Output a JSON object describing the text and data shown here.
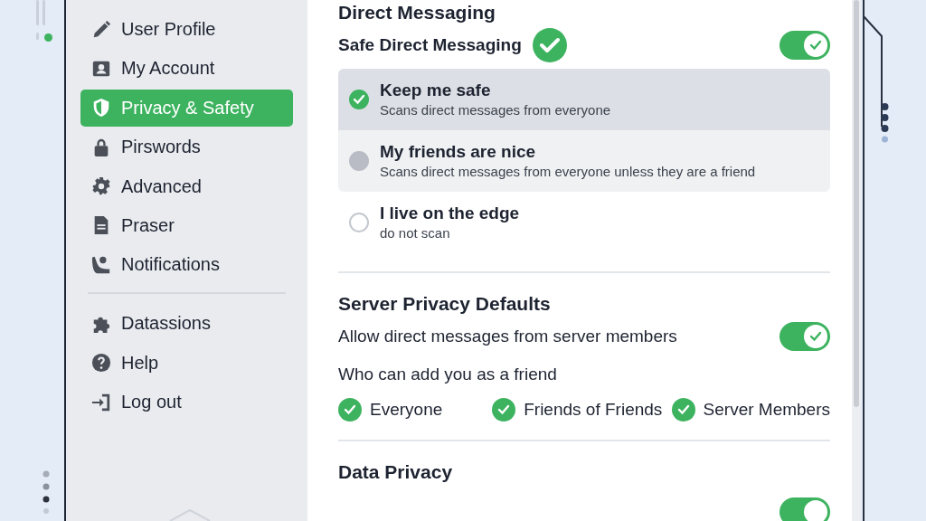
{
  "sidebar": {
    "groups": [
      [
        {
          "label": "User Profile",
          "selected": false
        },
        {
          "label": "My Account",
          "selected": false
        },
        {
          "label": "Privacy & Safety",
          "selected": true
        },
        {
          "label": "Pirswords",
          "selected": false
        },
        {
          "label": "Advanced",
          "selected": false
        },
        {
          "label": "Praser",
          "selected": false
        },
        {
          "label": "Notifications",
          "selected": false
        }
      ],
      [
        {
          "label": "Datassions",
          "selected": false
        },
        {
          "label": "Help",
          "selected": false
        },
        {
          "label": "Log out",
          "selected": false
        }
      ]
    ]
  },
  "direct_messaging": {
    "title": "Direct Messaging",
    "safe_toggle": {
      "label": "Safe Direct Messaging",
      "verified": true,
      "on": true
    },
    "options": [
      {
        "title": "Keep me safe",
        "description": "Scans direct messages from everyone",
        "selected": true,
        "highlighted": false
      },
      {
        "title": "My friends are nice",
        "description": "Scans direct messages from everyone unless they are a friend",
        "selected": false,
        "highlighted": true
      },
      {
        "title": "I live on the edge",
        "description": "do not scan",
        "selected": false,
        "highlighted": false
      }
    ]
  },
  "server_privacy": {
    "title": "Server Privacy Defaults",
    "dm_toggle": {
      "label": "Allow direct messages from server members",
      "on": true
    },
    "friend_label": "Who can add you as a friend",
    "friend_options": [
      {
        "label": "Everyone",
        "checked": true
      },
      {
        "label": "Friends of Friends",
        "checked": true
      },
      {
        "label": "Server Members",
        "checked": true
      }
    ]
  },
  "data_privacy": {
    "title": "Data Privacy",
    "toggle": {
      "on": true
    }
  }
}
